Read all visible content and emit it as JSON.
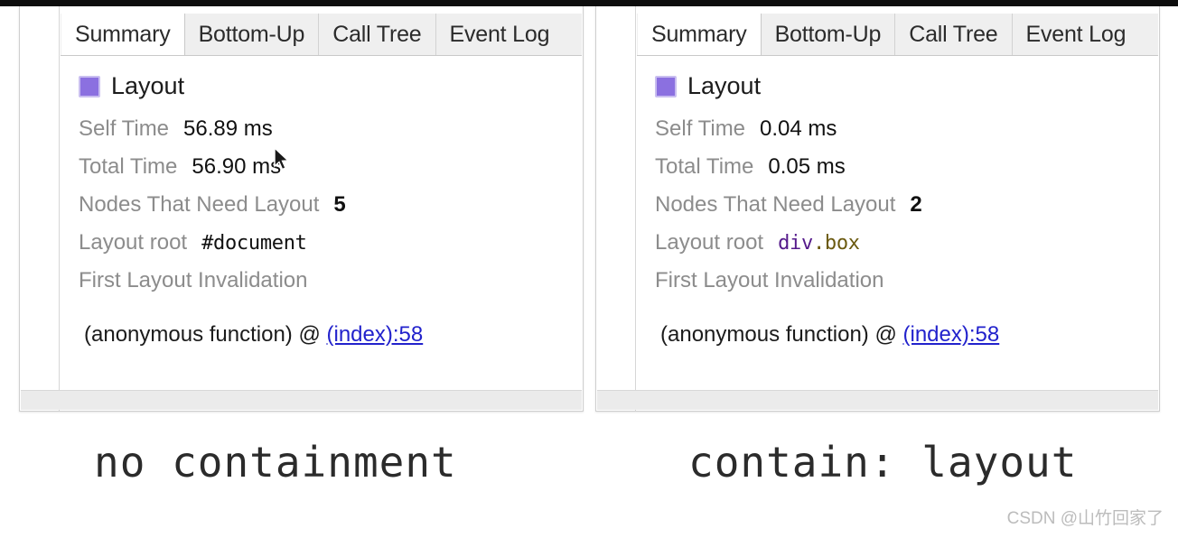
{
  "tabs": [
    {
      "label": "Summary",
      "active": true
    },
    {
      "label": "Bottom-Up",
      "active": false
    },
    {
      "label": "Call Tree",
      "active": false
    },
    {
      "label": "Event Log",
      "active": false
    }
  ],
  "colors": {
    "layout_swatch": "#8b70e0",
    "link": "#2222cc",
    "label_gray": "#8c8c8c",
    "tag_name": "#551a8b",
    "class_name": "#6b5a10"
  },
  "left_panel": {
    "event_title": "Layout",
    "rows": [
      {
        "label": "Self Time",
        "value": "56.89 ms"
      },
      {
        "label": "Total Time",
        "value": "56.90 ms"
      },
      {
        "label": "Nodes That Need Layout",
        "value": "5"
      }
    ],
    "layout_root_label": "Layout root",
    "layout_root_value": "#document",
    "invalidation_label": "First Layout Invalidation",
    "stack_prefix": "(anonymous function) @ ",
    "stack_link": "(index):58"
  },
  "right_panel": {
    "event_title": "Layout",
    "rows": [
      {
        "label": "Self Time",
        "value": "0.04 ms"
      },
      {
        "label": "Total Time",
        "value": "0.05 ms"
      },
      {
        "label": "Nodes That Need Layout",
        "value": "2"
      }
    ],
    "layout_root_label": "Layout root",
    "layout_root_tag": "div",
    "layout_root_class": ".box",
    "invalidation_label": "First Layout Invalidation",
    "stack_prefix": "(anonymous function) @ ",
    "stack_link": "(index):58"
  },
  "captions": {
    "left": "no containment",
    "right": "contain: layout"
  },
  "watermark": "CSDN @山竹回家了"
}
